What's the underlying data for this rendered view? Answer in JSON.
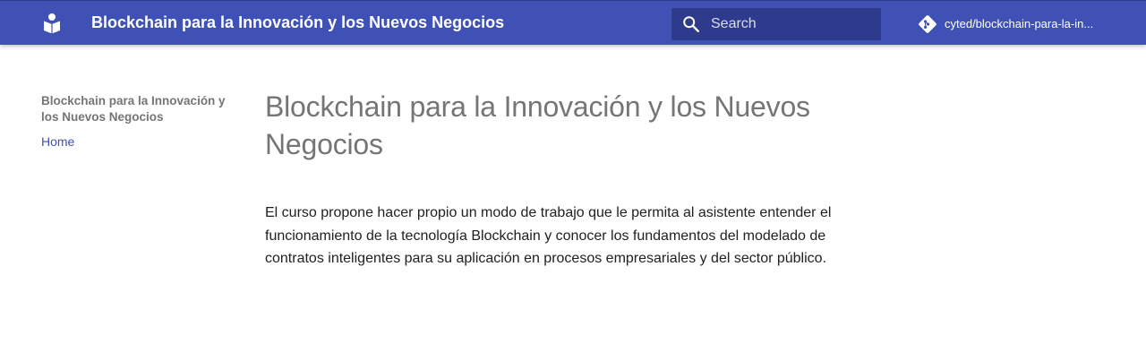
{
  "header": {
    "site_title": "Blockchain para la Innovación y los Nuevos Negocios",
    "logo_icon": "book-reader-icon",
    "search": {
      "placeholder": "Search",
      "value": "",
      "icon": "search-icon"
    },
    "repo": {
      "icon": "git-icon",
      "name": "cyted/blockchain-para-la-in..."
    }
  },
  "nav": {
    "title": "Blockchain para la Innovación y los Nuevos Negocios",
    "items": [
      {
        "label": "Home"
      }
    ]
  },
  "main": {
    "title": "Blockchain para la Innovación y los Nuevos Negocios",
    "intro": "El curso propone hacer propio un modo de trabajo que le permita al asistente entender el funcionamiento de la tecnología Blockchain y conocer los fundamentos del modelado de contratos inteligentes para su aplicación en procesos empresariales y del sector público."
  },
  "colors": {
    "primary": "#3f51b5",
    "search_bg": "#2e3b8c",
    "muted_text": "#757575",
    "body_text": "#212121",
    "link": "#3f51b5"
  }
}
